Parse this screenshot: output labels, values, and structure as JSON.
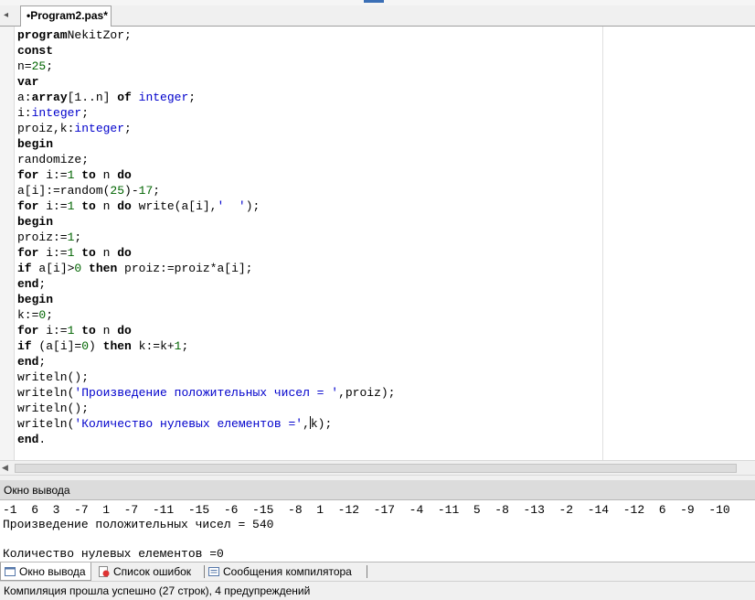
{
  "editor": {
    "file_tab_label": "•Program2.pas*",
    "code_lines": [
      [
        [
          "kw",
          "program"
        ],
        [
          "",
          "NekitZor;"
        ]
      ],
      [
        [
          "kw",
          "const"
        ]
      ],
      [
        [
          "",
          "n="
        ],
        [
          "nu",
          "25"
        ],
        [
          "",
          ";"
        ]
      ],
      [
        [
          "kw",
          "var"
        ]
      ],
      [
        [
          "",
          "a:"
        ],
        [
          "kw",
          "array"
        ],
        [
          "",
          "[1..n] "
        ],
        [
          "kw",
          "of"
        ],
        [
          "",
          ""
        ],
        [
          "ty",
          " integer"
        ],
        [
          "",
          ";"
        ]
      ],
      [
        [
          "",
          "i:"
        ],
        [
          "ty",
          "integer"
        ],
        [
          "",
          ";"
        ]
      ],
      [
        [
          "",
          "proiz,k:"
        ],
        [
          "ty",
          "integer"
        ],
        [
          "",
          ";"
        ]
      ],
      [
        [
          "kw",
          "begin"
        ]
      ],
      [
        [
          "",
          "randomize;"
        ]
      ],
      [
        [
          "kw",
          "for"
        ],
        [
          "",
          " i:="
        ],
        [
          "nu",
          "1"
        ],
        [
          "",
          ""
        ],
        [
          "kw",
          " to"
        ],
        [
          "",
          " n "
        ],
        [
          "kw",
          "do"
        ]
      ],
      [
        [
          "",
          "a[i]:=random("
        ],
        [
          "nu",
          "25"
        ],
        [
          "",
          ")-"
        ],
        [
          "nu",
          "17"
        ],
        [
          "",
          ";"
        ]
      ],
      [
        [
          "kw",
          "for"
        ],
        [
          "",
          " i:="
        ],
        [
          "nu",
          "1"
        ],
        [
          "kw",
          " to"
        ],
        [
          "",
          " n "
        ],
        [
          "kw",
          "do"
        ],
        [
          "",
          " write(a[i],"
        ],
        [
          "st",
          "'  '"
        ],
        [
          "",
          ");"
        ]
      ],
      [
        [
          "kw",
          "begin"
        ]
      ],
      [
        [
          "",
          "proiz:="
        ],
        [
          "nu",
          "1"
        ],
        [
          "",
          ";"
        ]
      ],
      [
        [
          "kw",
          "for"
        ],
        [
          "",
          " i:="
        ],
        [
          "nu",
          "1"
        ],
        [
          "kw",
          " to"
        ],
        [
          "",
          " n "
        ],
        [
          "kw",
          "do"
        ]
      ],
      [
        [
          "kw",
          "if"
        ],
        [
          "",
          " a[i]>"
        ],
        [
          "nu",
          "0"
        ],
        [
          "kw",
          " then"
        ],
        [
          "",
          " proiz:=proiz*a[i];"
        ]
      ],
      [
        [
          "kw",
          "end"
        ],
        [
          "",
          ";"
        ]
      ],
      [
        [
          "kw",
          "begin"
        ]
      ],
      [
        [
          "",
          "k:="
        ],
        [
          "nu",
          "0"
        ],
        [
          "",
          ";"
        ]
      ],
      [
        [
          "kw",
          "for"
        ],
        [
          "",
          " i:="
        ],
        [
          "nu",
          "1"
        ],
        [
          "kw",
          " to"
        ],
        [
          "",
          " n "
        ],
        [
          "kw",
          "do"
        ]
      ],
      [
        [
          "kw",
          "if"
        ],
        [
          "",
          " (a[i]="
        ],
        [
          "nu",
          "0"
        ],
        [
          "",
          ") "
        ],
        [
          "kw",
          "then"
        ],
        [
          "",
          " k:=k+"
        ],
        [
          "nu",
          "1"
        ],
        [
          "",
          ";"
        ]
      ],
      [
        [
          "kw",
          "end"
        ],
        [
          "",
          ";"
        ]
      ],
      [
        [
          "",
          "writeln();"
        ]
      ],
      [
        [
          "",
          "writeln("
        ],
        [
          "st",
          "'Произведение положительных чисел = '"
        ],
        [
          "",
          ",proiz);"
        ]
      ],
      [
        [
          "",
          "writeln();"
        ]
      ],
      [
        [
          "",
          "writeln("
        ],
        [
          "st",
          "'Количество нулевых елементов ='"
        ],
        [
          "",
          ","
        ],
        [
          "caret",
          ""
        ],
        [
          "",
          "k);"
        ]
      ],
      [
        [
          "kw",
          "end"
        ],
        [
          "",
          "."
        ]
      ]
    ]
  },
  "output_panel": {
    "title": "Окно вывода",
    "lines": [
      "-1  6  3  -7  1  -7  -11  -15  -6  -15  -8  1  -12  -17  -4  -11  5  -8  -13  -2  -14  -12  6  -9  -10",
      "Произведение положительных чисел = 540",
      "",
      "Количество нулевых елементов =0"
    ]
  },
  "bottom_tabs": [
    {
      "label": "Окно вывода",
      "icon": "output-window-icon",
      "active": true
    },
    {
      "label": "Список ошибок",
      "icon": "error-list-icon",
      "active": false
    },
    {
      "label": "Сообщения компилятора",
      "icon": "compiler-messages-icon",
      "active": false
    }
  ],
  "status": {
    "text": "Компиляция прошла успешно (27 строк), 4 предупреждений"
  }
}
